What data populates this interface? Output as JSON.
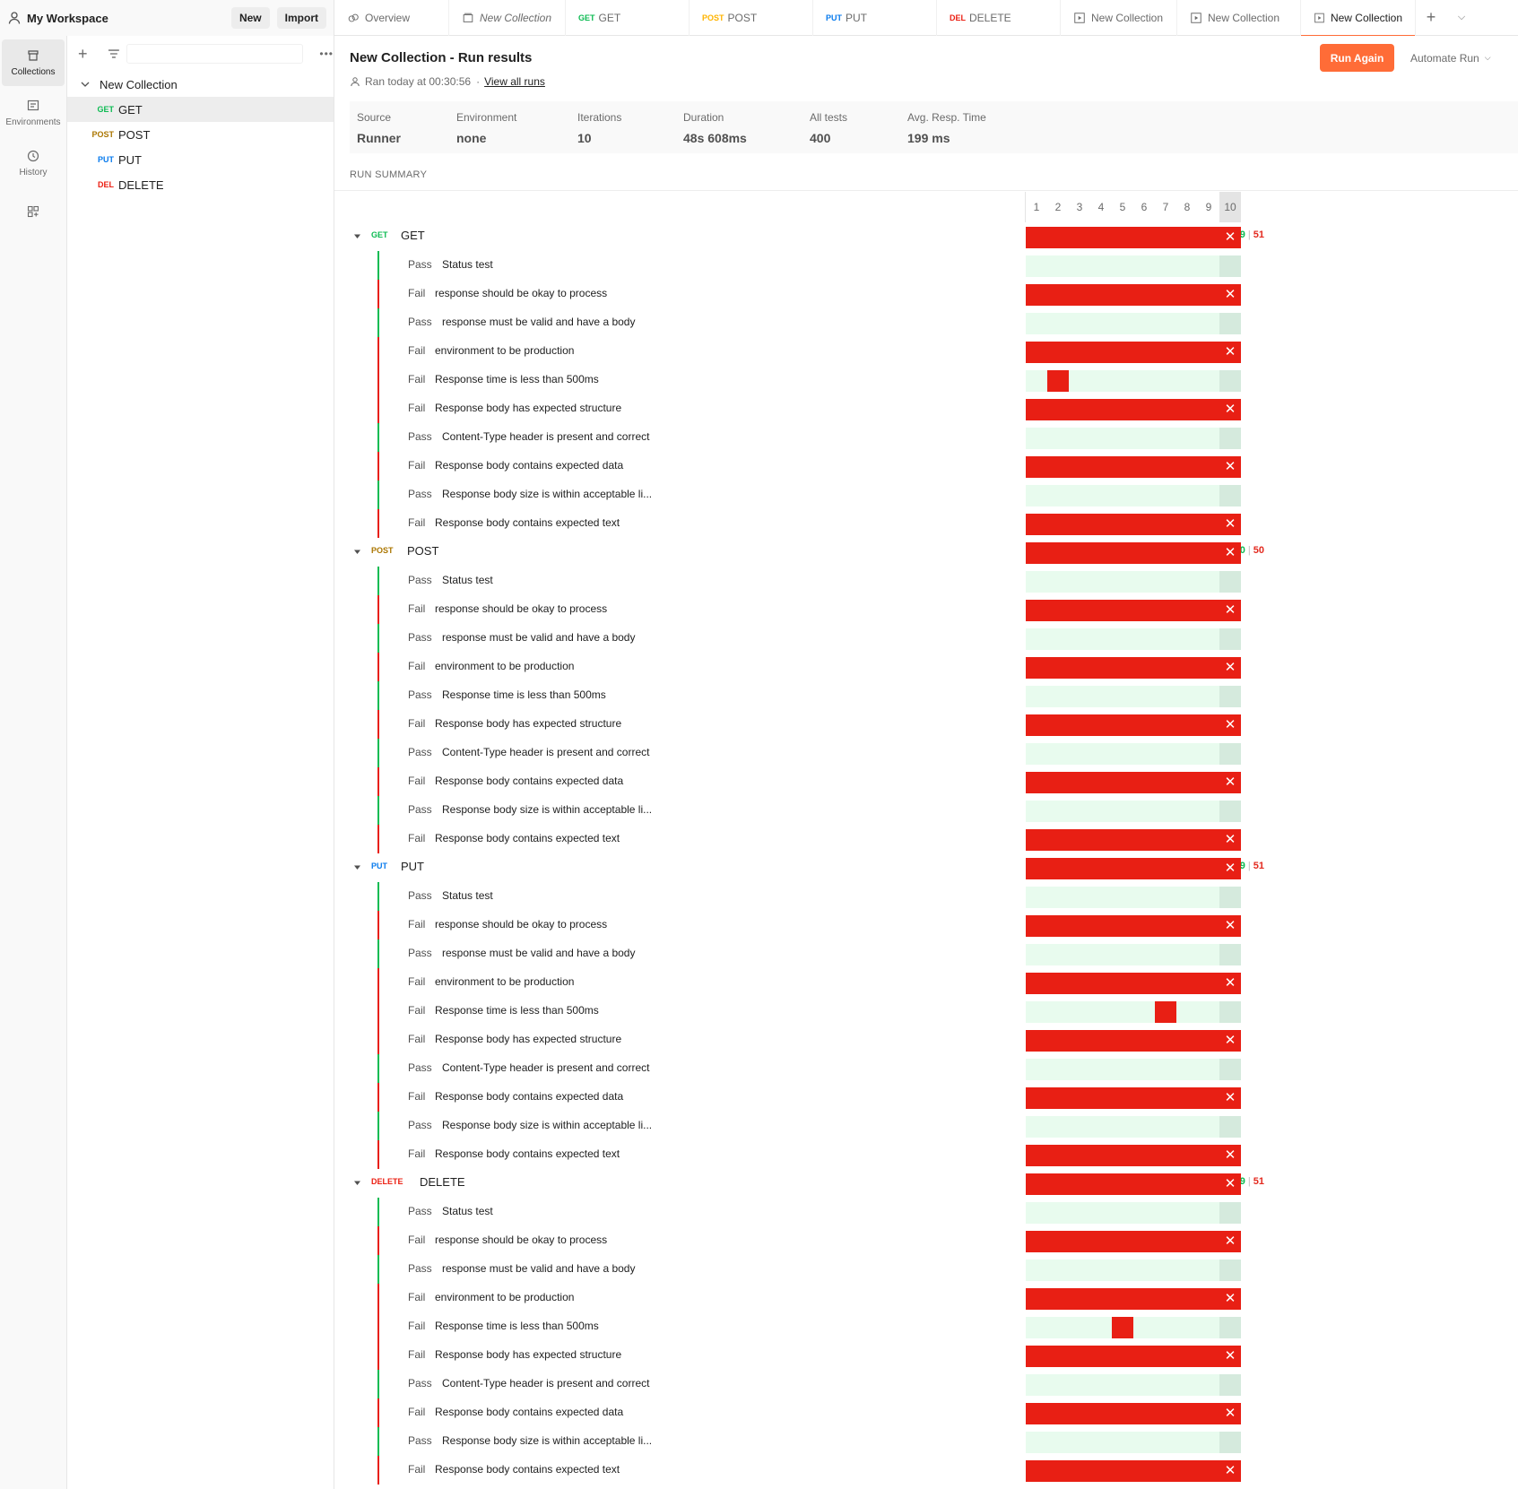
{
  "workspace": {
    "title": "My Workspace",
    "new_label": "New",
    "import_label": "Import"
  },
  "tabs": [
    {
      "icon": "overview-icon",
      "label": "Overview",
      "italic": false,
      "method": "",
      "method_color": ""
    },
    {
      "icon": "collection-icon",
      "label": "New Collection",
      "italic": true,
      "method": "",
      "method_color": ""
    },
    {
      "icon": "",
      "label": "GET",
      "italic": false,
      "method": "GET",
      "method_color": "#0cbb52"
    },
    {
      "icon": "",
      "label": "POST",
      "italic": false,
      "method": "POST",
      "method_color": "#ffb400"
    },
    {
      "icon": "",
      "label": "PUT",
      "italic": false,
      "method": "PUT",
      "method_color": "#097bed"
    },
    {
      "icon": "",
      "label": "DELETE",
      "italic": false,
      "method": "DEL",
      "method_color": "#eb2013"
    },
    {
      "icon": "runner-icon",
      "label": "New Collection",
      "italic": false,
      "method": "",
      "method_color": ""
    },
    {
      "icon": "runner-icon",
      "label": "New Collection",
      "italic": false,
      "method": "",
      "method_color": ""
    },
    {
      "icon": "runner-icon",
      "label": "New Collection",
      "italic": false,
      "method": "",
      "method_color": "",
      "active": true
    }
  ],
  "rail": [
    {
      "label": "Collections",
      "icon": "collections-icon",
      "active": true
    },
    {
      "label": "Environments",
      "icon": "environments-icon",
      "active": false
    },
    {
      "label": "History",
      "icon": "history-icon",
      "active": false
    },
    {
      "label": "",
      "icon": "apps-icon",
      "active": false
    }
  ],
  "sidebar": {
    "collection": "New Collection",
    "requests": [
      {
        "method": "GET",
        "name": "GET",
        "color": "#0cbb52",
        "selected": true
      },
      {
        "method": "POST",
        "name": "POST",
        "color": "#ab7600",
        "selected": false
      },
      {
        "method": "PUT",
        "name": "PUT",
        "color": "#097bed",
        "selected": false
      },
      {
        "method": "DEL",
        "name": "DELETE",
        "color": "#eb2013",
        "selected": false
      }
    ]
  },
  "header": {
    "title": "New Collection - Run results",
    "ran": "Ran today at 00:30:56",
    "dot": "·",
    "view_all": "View all runs",
    "run_again": "Run Again",
    "automate": "Automate Run"
  },
  "stats": [
    {
      "key": "Source",
      "value": "Runner"
    },
    {
      "key": "Environment",
      "value": "none"
    },
    {
      "key": "Iterations",
      "value": "10"
    },
    {
      "key": "Duration",
      "value": "48s 608ms"
    },
    {
      "key": "All tests",
      "value": "400"
    },
    {
      "key": "Avg. Resp. Time",
      "value": "199 ms"
    }
  ],
  "run_summary": {
    "label": "RUN SUMMARY",
    "iterations": [
      "1",
      "2",
      "3",
      "4",
      "5",
      "6",
      "7",
      "8",
      "9",
      "10"
    ],
    "requests": [
      {
        "method": "GET",
        "name": "GET",
        "color": "#0cbb52",
        "passed": "49",
        "failed": "51",
        "tests": [
          {
            "status": "Pass",
            "name": "Status test",
            "fail_iterations": []
          },
          {
            "status": "Fail",
            "name": "response should be okay to process",
            "fail_iterations": "all"
          },
          {
            "status": "Pass",
            "name": "response must be valid and have a body",
            "fail_iterations": []
          },
          {
            "status": "Fail",
            "name": "environment to be production",
            "fail_iterations": "all"
          },
          {
            "status": "Fail",
            "name": "Response time is less than 500ms",
            "fail_iterations": [
              2
            ]
          },
          {
            "status": "Fail",
            "name": "Response body has expected structure",
            "fail_iterations": "all"
          },
          {
            "status": "Pass",
            "name": "Content-Type header is present and correct",
            "fail_iterations": []
          },
          {
            "status": "Fail",
            "name": "Response body contains expected data",
            "fail_iterations": "all"
          },
          {
            "status": "Pass",
            "name": "Response body size is within acceptable li...",
            "fail_iterations": []
          },
          {
            "status": "Fail",
            "name": "Response body contains expected text",
            "fail_iterations": "all"
          }
        ]
      },
      {
        "method": "POST",
        "name": "POST",
        "color": "#ab7600",
        "passed": "50",
        "failed": "50",
        "tests": [
          {
            "status": "Pass",
            "name": "Status test",
            "fail_iterations": []
          },
          {
            "status": "Fail",
            "name": "response should be okay to process",
            "fail_iterations": "all"
          },
          {
            "status": "Pass",
            "name": "response must be valid and have a body",
            "fail_iterations": []
          },
          {
            "status": "Fail",
            "name": "environment to be production",
            "fail_iterations": "all"
          },
          {
            "status": "Pass",
            "name": "Response time is less than 500ms",
            "fail_iterations": []
          },
          {
            "status": "Fail",
            "name": "Response body has expected structure",
            "fail_iterations": "all"
          },
          {
            "status": "Pass",
            "name": "Content-Type header is present and correct",
            "fail_iterations": []
          },
          {
            "status": "Fail",
            "name": "Response body contains expected data",
            "fail_iterations": "all"
          },
          {
            "status": "Pass",
            "name": "Response body size is within acceptable li...",
            "fail_iterations": []
          },
          {
            "status": "Fail",
            "name": "Response body contains expected text",
            "fail_iterations": "all"
          }
        ]
      },
      {
        "method": "PUT",
        "name": "PUT",
        "color": "#097bed",
        "passed": "49",
        "failed": "51",
        "tests": [
          {
            "status": "Pass",
            "name": "Status test",
            "fail_iterations": []
          },
          {
            "status": "Fail",
            "name": "response should be okay to process",
            "fail_iterations": "all"
          },
          {
            "status": "Pass",
            "name": "response must be valid and have a body",
            "fail_iterations": []
          },
          {
            "status": "Fail",
            "name": "environment to be production",
            "fail_iterations": "all"
          },
          {
            "status": "Fail",
            "name": "Response time is less than 500ms",
            "fail_iterations": [
              7
            ]
          },
          {
            "status": "Fail",
            "name": "Response body has expected structure",
            "fail_iterations": "all"
          },
          {
            "status": "Pass",
            "name": "Content-Type header is present and correct",
            "fail_iterations": []
          },
          {
            "status": "Fail",
            "name": "Response body contains expected data",
            "fail_iterations": "all"
          },
          {
            "status": "Pass",
            "name": "Response body size is within acceptable li...",
            "fail_iterations": []
          },
          {
            "status": "Fail",
            "name": "Response body contains expected text",
            "fail_iterations": "all"
          }
        ]
      },
      {
        "method": "DELETE",
        "name": "DELETE",
        "color": "#eb2013",
        "passed": "49",
        "failed": "51",
        "tests": [
          {
            "status": "Pass",
            "name": "Status test",
            "fail_iterations": []
          },
          {
            "status": "Fail",
            "name": "response should be okay to process",
            "fail_iterations": "all"
          },
          {
            "status": "Pass",
            "name": "response must be valid and have a body",
            "fail_iterations": []
          },
          {
            "status": "Fail",
            "name": "environment to be production",
            "fail_iterations": "all"
          },
          {
            "status": "Fail",
            "name": "Response time is less than 500ms",
            "fail_iterations": [
              5
            ]
          },
          {
            "status": "Fail",
            "name": "Response body has expected structure",
            "fail_iterations": "all"
          },
          {
            "status": "Pass",
            "name": "Content-Type header is present and correct",
            "fail_iterations": []
          },
          {
            "status": "Fail",
            "name": "Response body contains expected data",
            "fail_iterations": "all"
          },
          {
            "status": "Pass",
            "name": "Response body size is within acceptable li...",
            "fail_iterations": []
          },
          {
            "status": "Fail",
            "name": "Response body contains expected text",
            "fail_iterations": "all"
          }
        ]
      }
    ]
  },
  "colors": {
    "pass": "#0cbb52",
    "fail": "#e81f14",
    "accent": "#ff6c37"
  }
}
